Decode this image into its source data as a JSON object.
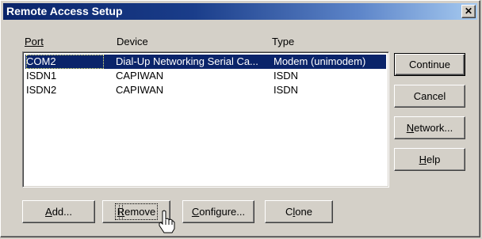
{
  "window": {
    "title": "Remote Access Setup",
    "close_glyph": "✕"
  },
  "columns": {
    "port": "Port",
    "device": "Device",
    "type": "Type"
  },
  "rows": [
    {
      "port": "COM2",
      "device": "Dial-Up Networking Serial Ca...",
      "type": "Modem (unimodem)",
      "selected": true
    },
    {
      "port": "ISDN1",
      "device": "CAPIWAN",
      "type": "ISDN",
      "selected": false
    },
    {
      "port": "ISDN2",
      "device": "CAPIWAN",
      "type": "ISDN",
      "selected": false
    }
  ],
  "side_buttons": {
    "continue": "Continue",
    "cancel": "Cancel",
    "network_pre": "",
    "network_ul": "N",
    "network_post": "etwork...",
    "help_pre": "",
    "help_ul": "H",
    "help_post": "elp"
  },
  "bottom_buttons": {
    "add_pre": "",
    "add_ul": "A",
    "add_post": "dd...",
    "remove_pre": "",
    "remove_ul": "R",
    "remove_post": "emove",
    "configure_pre": "",
    "configure_ul": "C",
    "configure_post": "onfigure...",
    "clone_pre": "C",
    "clone_ul": "l",
    "clone_post": "one"
  },
  "colors": {
    "face": "#d4d0c8",
    "title_start": "#0a246a",
    "title_end": "#a6caf0",
    "selection": "#0a246a"
  }
}
